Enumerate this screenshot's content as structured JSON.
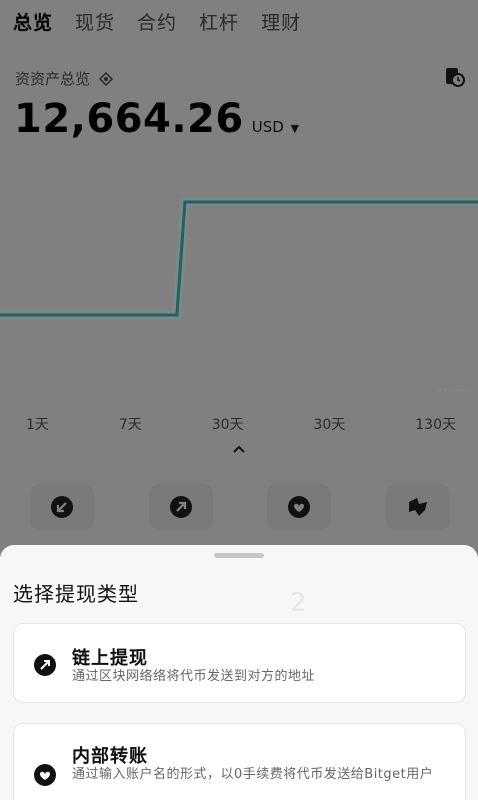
{
  "tabs": [
    {
      "label": "总览",
      "active": true
    },
    {
      "label": "现货",
      "active": false
    },
    {
      "label": "合约",
      "active": false
    },
    {
      "label": "杠杆",
      "active": false
    },
    {
      "label": "理财",
      "active": false
    }
  ],
  "assets": {
    "label": "资资产总览",
    "balance": "12,664.26",
    "currency": "USD"
  },
  "chart_data": {
    "type": "line",
    "series": [
      {
        "values": [
          0,
          0,
          1,
          1
        ]
      }
    ],
    "color": "#2b5e5c"
  },
  "ranges": [
    "1天",
    "7天",
    "30天",
    "30天",
    "130天"
  ],
  "actions": [
    {
      "icon": "deposit-icon"
    },
    {
      "icon": "withdraw-icon"
    },
    {
      "icon": "transfer-icon"
    },
    {
      "icon": "convert-icon"
    }
  ],
  "sheet": {
    "title": "选择提现类型",
    "ghost_number": "2",
    "options": [
      {
        "title": "链上提现",
        "desc": "通过区块网络络将代币发送到对方的地址",
        "icon": "onchain-icon"
      },
      {
        "title": "内部转账",
        "desc": "通过输入账户名的形式，以0手续费将代币发送给Bitget用户",
        "icon": "internal-icon"
      }
    ]
  },
  "colors": {
    "overlay": "#808080",
    "sheet": "#f7f7f7",
    "chart_line": "#2b5e5c"
  }
}
